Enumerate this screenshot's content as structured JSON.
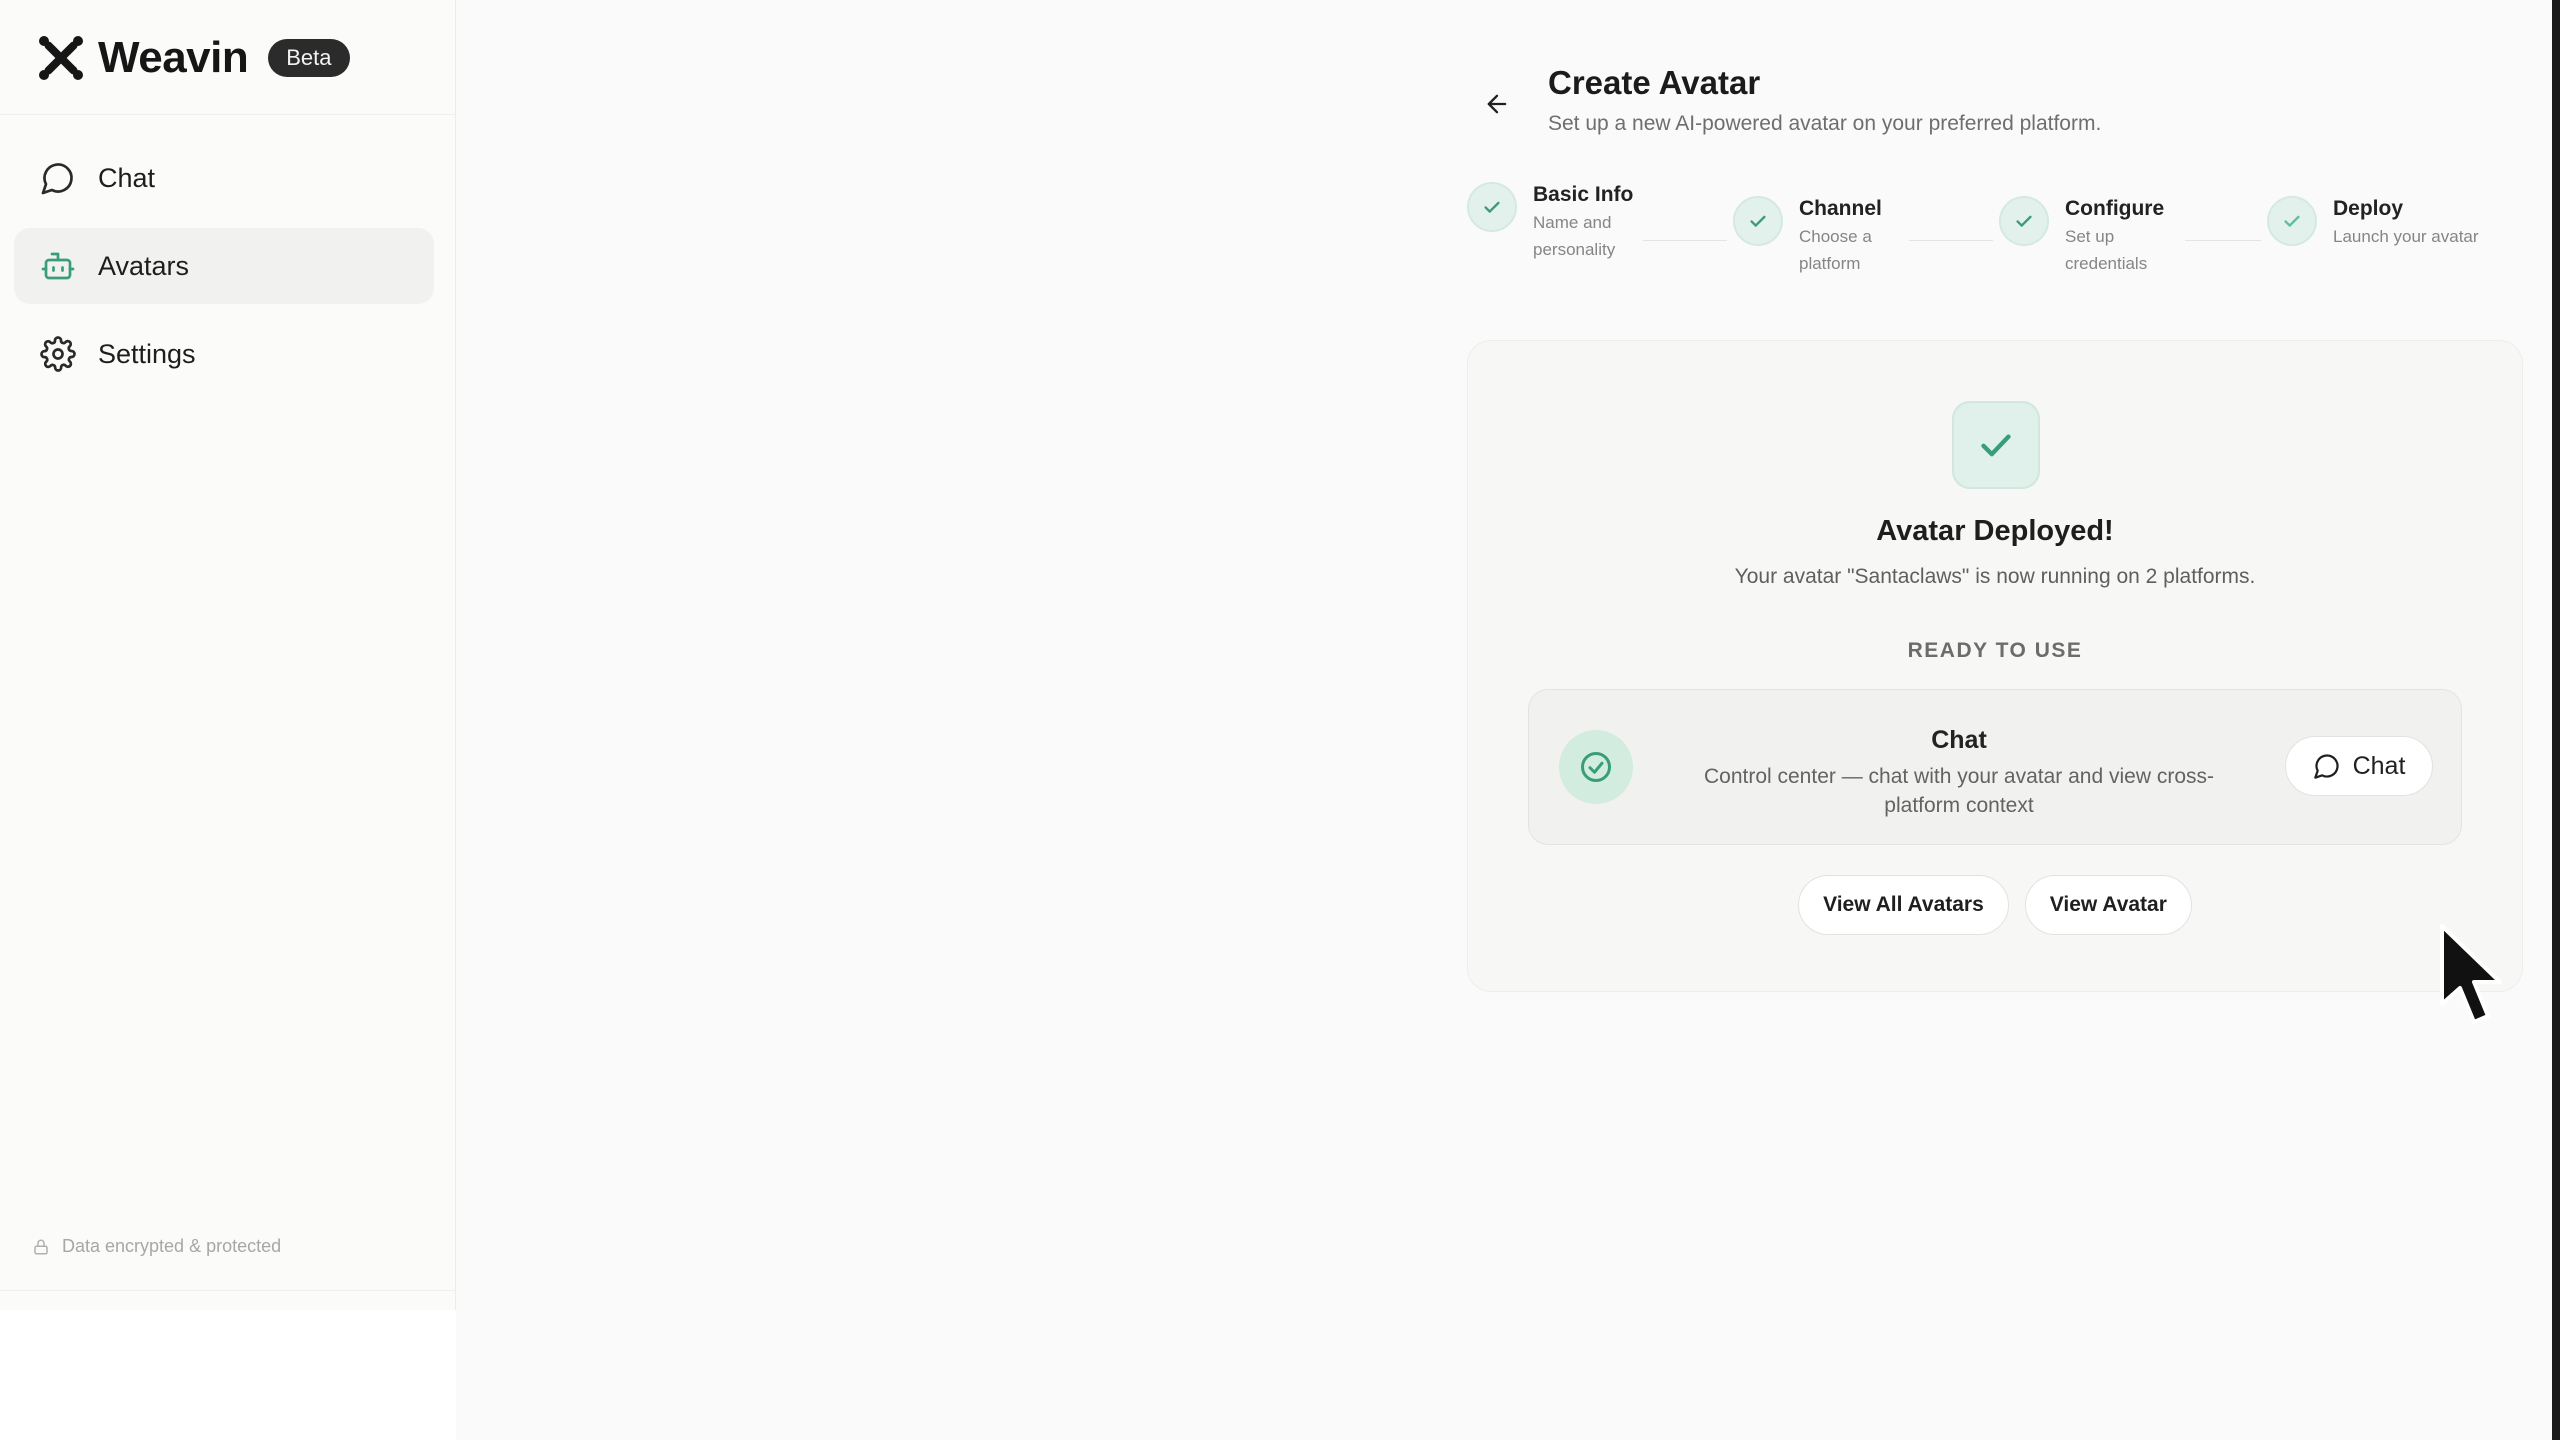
{
  "brand": {
    "name": "Weavin",
    "badge": "Beta"
  },
  "sidebar": {
    "items": [
      {
        "label": "Chat",
        "icon": "chat-bubble-icon",
        "active": false
      },
      {
        "label": "Avatars",
        "icon": "robot-icon",
        "active": true
      },
      {
        "label": "Settings",
        "icon": "gear-icon",
        "active": false
      }
    ],
    "footer": "Data encrypted & protected"
  },
  "header": {
    "title": "Create Avatar",
    "subtitle": "Set up a new AI-powered avatar on your preferred platform."
  },
  "steps": [
    {
      "title": "Basic Info",
      "desc": "Name and personality",
      "status": "complete"
    },
    {
      "title": "Channel",
      "desc": "Choose a platform",
      "status": "complete"
    },
    {
      "title": "Configure",
      "desc": "Set up credentials",
      "status": "complete"
    },
    {
      "title": "Deploy",
      "desc": "Launch your avatar",
      "status": "complete"
    }
  ],
  "result": {
    "title": "Avatar Deployed!",
    "subtitle": "Your avatar \"Santaclaws\" is now running on 2 platforms.",
    "ready_label": "READY TO USE",
    "platform": {
      "name": "Chat",
      "description": "Control center — chat with your avatar and view cross-platform context",
      "button_label": "Chat"
    },
    "actions": {
      "view_all": "View All Avatars",
      "view_one": "View Avatar"
    }
  },
  "colors": {
    "accent_green": "#3a9d7a",
    "accent_bg": "#e0f0ea",
    "sidebar_active": "#f1f1f0"
  }
}
